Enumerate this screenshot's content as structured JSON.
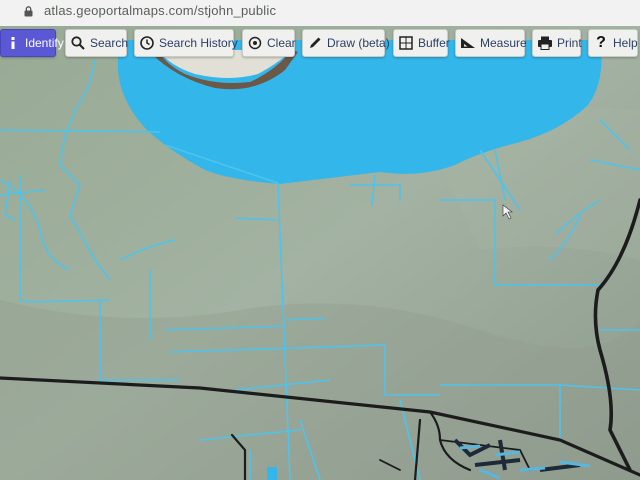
{
  "browser": {
    "url": "atlas.geoportalmaps.com/stjohn_public",
    "lock_icon": "lock-icon"
  },
  "toolbar": {
    "identify": {
      "label": "Identify",
      "icon": "identify-icon",
      "active": true
    },
    "search": {
      "label": "Search",
      "icon": "search-icon"
    },
    "search_history": {
      "label": "Search History",
      "icon": "clock-icon"
    },
    "clear": {
      "label": "Clear",
      "icon": "clear-icon"
    },
    "draw": {
      "label": "Draw (beta)",
      "icon": "pencil-icon"
    },
    "buffer": {
      "label": "Buffer",
      "icon": "buffer-icon"
    },
    "measure": {
      "label": "Measure",
      "icon": "ruler-icon"
    },
    "print": {
      "label": "Print",
      "icon": "printer-icon"
    },
    "help": {
      "label": "Help",
      "icon": "help-icon"
    }
  },
  "map": {
    "colors": {
      "lake": "#33b6ea",
      "land": "#9fae9e",
      "parcel_lines": "#4cc4ec",
      "roads": "#1c1c1c",
      "shore_dark": "#6b5846"
    }
  }
}
